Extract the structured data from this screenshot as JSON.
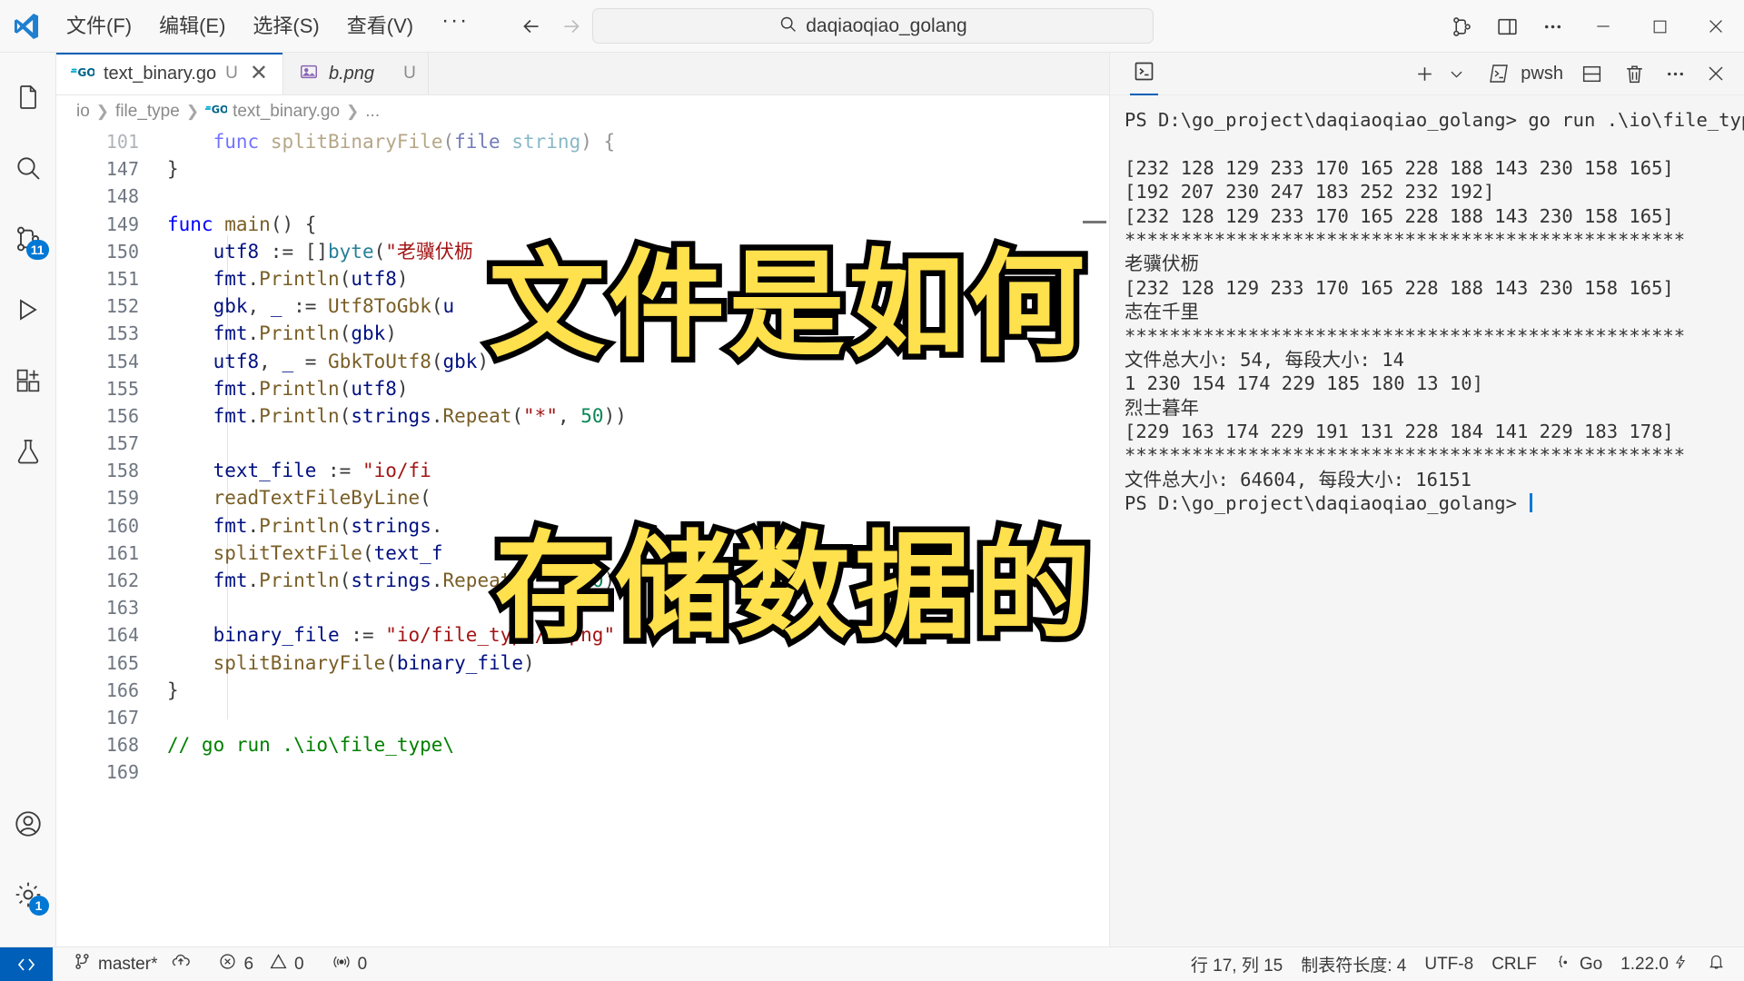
{
  "window": {
    "logo_icon": "vscode-logo-icon",
    "menus": [
      "文件(F)",
      "编辑(E)",
      "选择(S)",
      "查看(V)"
    ],
    "menu_more": "···",
    "nav_back_icon": "arrow-left-icon",
    "nav_forward_icon": "arrow-right-icon",
    "quick_open": {
      "search_icon": "search-icon",
      "value": "daqiaoqiao_golang"
    },
    "right_icons": [
      "source-control-graph-icon",
      "toggle-panel-icon",
      "more-actions-icon"
    ],
    "controls": {
      "minimize": "minimize-icon",
      "maximize": "maximize-icon",
      "close": "close-icon"
    }
  },
  "activitybar": {
    "items": [
      {
        "name": "explorer",
        "icon": "files-icon",
        "badge": ""
      },
      {
        "name": "search",
        "icon": "search-icon",
        "badge": ""
      },
      {
        "name": "source-control",
        "icon": "source-control-icon",
        "badge": "11"
      },
      {
        "name": "run-and-debug",
        "icon": "run-debug-icon",
        "badge": ""
      },
      {
        "name": "extensions",
        "icon": "extensions-icon",
        "badge": ""
      },
      {
        "name": "testing",
        "icon": "beaker-icon",
        "badge": ""
      }
    ],
    "bottom": [
      {
        "name": "accounts",
        "icon": "account-icon",
        "badge": ""
      },
      {
        "name": "manage",
        "icon": "gear-icon",
        "badge": "1"
      }
    ]
  },
  "editor": {
    "tabs": [
      {
        "icon": "go-file-icon",
        "label": "text_binary.go",
        "dirty": "U",
        "active": true,
        "preview": false,
        "close_icon": "close-icon"
      },
      {
        "icon": "image-file-icon",
        "label": "b.png",
        "dirty": "U",
        "active": false,
        "preview": true,
        "close_icon": ""
      }
    ],
    "breadcrumb": [
      "io",
      "file_type",
      "text_binary.go",
      "..."
    ],
    "breadcrumb_file_icon": "go-file-icon",
    "lines": [
      {
        "num": "101",
        "partial": true,
        "tokens": [
          {
            "t": "    ",
            "c": "pn"
          },
          {
            "t": "func",
            "c": "k"
          },
          {
            "t": " ",
            "c": "pn"
          },
          {
            "t": "splitBinaryFile",
            "c": "fn"
          },
          {
            "t": "(",
            "c": "pn"
          },
          {
            "t": "file",
            "c": "va"
          },
          {
            "t": " ",
            "c": "pn"
          },
          {
            "t": "string",
            "c": "ty"
          },
          {
            "t": ") {",
            "c": "pn"
          }
        ]
      },
      {
        "num": "147",
        "partial": false,
        "tokens": [
          {
            "t": "}",
            "c": "pn"
          }
        ]
      },
      {
        "num": "148",
        "partial": false,
        "tokens": []
      },
      {
        "num": "149",
        "partial": false,
        "tokens": [
          {
            "t": "func",
            "c": "k"
          },
          {
            "t": " ",
            "c": "pn"
          },
          {
            "t": "main",
            "c": "fn"
          },
          {
            "t": "() {",
            "c": "pn"
          }
        ]
      },
      {
        "num": "150",
        "partial": false,
        "tokens": [
          {
            "t": "    ",
            "c": "pn"
          },
          {
            "t": "utf8",
            "c": "va"
          },
          {
            "t": " := []",
            "c": "pn"
          },
          {
            "t": "byte",
            "c": "ty"
          },
          {
            "t": "(",
            "c": "pn"
          },
          {
            "t": "\"老骥伏枥",
            "c": "st"
          }
        ]
      },
      {
        "num": "151",
        "partial": false,
        "tokens": [
          {
            "t": "    ",
            "c": "pn"
          },
          {
            "t": "fmt",
            "c": "va"
          },
          {
            "t": ".",
            "c": "pn"
          },
          {
            "t": "Println",
            "c": "fn"
          },
          {
            "t": "(",
            "c": "pn"
          },
          {
            "t": "utf8",
            "c": "va"
          },
          {
            "t": ")",
            "c": "pn"
          }
        ]
      },
      {
        "num": "152",
        "partial": false,
        "tokens": [
          {
            "t": "    ",
            "c": "pn"
          },
          {
            "t": "gbk",
            "c": "va"
          },
          {
            "t": ", ",
            "c": "pn"
          },
          {
            "t": "_",
            "c": "va"
          },
          {
            "t": " := ",
            "c": "pn"
          },
          {
            "t": "Utf8ToGbk",
            "c": "fn"
          },
          {
            "t": "(",
            "c": "pn"
          },
          {
            "t": "u",
            "c": "va"
          }
        ]
      },
      {
        "num": "153",
        "partial": false,
        "tokens": [
          {
            "t": "    ",
            "c": "pn"
          },
          {
            "t": "fmt",
            "c": "va"
          },
          {
            "t": ".",
            "c": "pn"
          },
          {
            "t": "Println",
            "c": "fn"
          },
          {
            "t": "(",
            "c": "pn"
          },
          {
            "t": "gbk",
            "c": "va"
          },
          {
            "t": ")",
            "c": "pn"
          }
        ]
      },
      {
        "num": "154",
        "partial": false,
        "tokens": [
          {
            "t": "    ",
            "c": "pn"
          },
          {
            "t": "utf8",
            "c": "va"
          },
          {
            "t": ", ",
            "c": "pn"
          },
          {
            "t": "_",
            "c": "va"
          },
          {
            "t": " = ",
            "c": "pn"
          },
          {
            "t": "GbkToUtf8",
            "c": "fn"
          },
          {
            "t": "(",
            "c": "pn"
          },
          {
            "t": "gbk",
            "c": "va"
          },
          {
            "t": ")",
            "c": "pn"
          }
        ]
      },
      {
        "num": "155",
        "partial": false,
        "tokens": [
          {
            "t": "    ",
            "c": "pn"
          },
          {
            "t": "fmt",
            "c": "va"
          },
          {
            "t": ".",
            "c": "pn"
          },
          {
            "t": "Println",
            "c": "fn"
          },
          {
            "t": "(",
            "c": "pn"
          },
          {
            "t": "utf8",
            "c": "va"
          },
          {
            "t": ")",
            "c": "pn"
          }
        ]
      },
      {
        "num": "156",
        "partial": false,
        "tokens": [
          {
            "t": "    ",
            "c": "pn"
          },
          {
            "t": "fmt",
            "c": "va"
          },
          {
            "t": ".",
            "c": "pn"
          },
          {
            "t": "Println",
            "c": "fn"
          },
          {
            "t": "(",
            "c": "pn"
          },
          {
            "t": "strings",
            "c": "va"
          },
          {
            "t": ".",
            "c": "pn"
          },
          {
            "t": "Repeat",
            "c": "fn"
          },
          {
            "t": "(",
            "c": "pn"
          },
          {
            "t": "\"*\"",
            "c": "st"
          },
          {
            "t": ", ",
            "c": "pn"
          },
          {
            "t": "50",
            "c": "nu"
          },
          {
            "t": "))",
            "c": "pn"
          }
        ]
      },
      {
        "num": "157",
        "partial": false,
        "tokens": []
      },
      {
        "num": "158",
        "partial": false,
        "tokens": [
          {
            "t": "    ",
            "c": "pn"
          },
          {
            "t": "text_file",
            "c": "va"
          },
          {
            "t": " := ",
            "c": "pn"
          },
          {
            "t": "\"io/fi",
            "c": "st"
          }
        ]
      },
      {
        "num": "159",
        "partial": false,
        "tokens": [
          {
            "t": "    ",
            "c": "pn"
          },
          {
            "t": "readTextFileByLine",
            "c": "fn"
          },
          {
            "t": "(",
            "c": "pn"
          }
        ]
      },
      {
        "num": "160",
        "partial": false,
        "tokens": [
          {
            "t": "    ",
            "c": "pn"
          },
          {
            "t": "fmt",
            "c": "va"
          },
          {
            "t": ".",
            "c": "pn"
          },
          {
            "t": "Println",
            "c": "fn"
          },
          {
            "t": "(",
            "c": "pn"
          },
          {
            "t": "strings",
            "c": "va"
          },
          {
            "t": ".",
            "c": "pn"
          }
        ]
      },
      {
        "num": "161",
        "partial": false,
        "tokens": [
          {
            "t": "    ",
            "c": "pn"
          },
          {
            "t": "splitTextFile",
            "c": "fn"
          },
          {
            "t": "(",
            "c": "pn"
          },
          {
            "t": "text_f",
            "c": "va"
          }
        ]
      },
      {
        "num": "162",
        "partial": false,
        "tokens": [
          {
            "t": "    ",
            "c": "pn"
          },
          {
            "t": "fmt",
            "c": "va"
          },
          {
            "t": ".",
            "c": "pn"
          },
          {
            "t": "Println",
            "c": "fn"
          },
          {
            "t": "(",
            "c": "pn"
          },
          {
            "t": "strings",
            "c": "va"
          },
          {
            "t": ".",
            "c": "pn"
          },
          {
            "t": "Repeat",
            "c": "fn"
          },
          {
            "t": "(",
            "c": "pn"
          },
          {
            "t": "\"*\"",
            "c": "st"
          },
          {
            "t": ", ",
            "c": "pn"
          },
          {
            "t": "50",
            "c": "nu"
          },
          {
            "t": "))",
            "c": "pn"
          }
        ]
      },
      {
        "num": "163",
        "partial": false,
        "tokens": []
      },
      {
        "num": "164",
        "partial": false,
        "tokens": [
          {
            "t": "    ",
            "c": "pn"
          },
          {
            "t": "binary_file",
            "c": "va"
          },
          {
            "t": " := ",
            "c": "pn"
          },
          {
            "t": "\"io/file_type/b.png\"",
            "c": "st"
          }
        ]
      },
      {
        "num": "165",
        "partial": false,
        "tokens": [
          {
            "t": "    ",
            "c": "pn"
          },
          {
            "t": "splitBinaryFile",
            "c": "fn"
          },
          {
            "t": "(",
            "c": "pn"
          },
          {
            "t": "binary_file",
            "c": "va"
          },
          {
            "t": ")",
            "c": "pn"
          }
        ]
      },
      {
        "num": "166",
        "partial": false,
        "tokens": [
          {
            "t": "}",
            "c": "pn"
          }
        ]
      },
      {
        "num": "167",
        "partial": false,
        "tokens": []
      },
      {
        "num": "168",
        "partial": false,
        "tokens": [
          {
            "t": "// go run .\\io\\file_type\\",
            "c": "cm"
          }
        ]
      },
      {
        "num": "169",
        "partial": false,
        "tokens": []
      }
    ]
  },
  "terminal": {
    "tab_icon": "terminal-icon",
    "toolbar": {
      "new_icon": "plus-icon",
      "dropdown_icon": "chevron-down-icon",
      "shell_icon": "terminal-icon",
      "shell_label": "pwsh",
      "split_icon": "split-panel-icon",
      "kill_icon": "trash-icon",
      "more_icon": "more-actions-icon",
      "close_icon": "close-icon"
    },
    "lines": [
      "PS D:\\go_project\\daqiaoqiao_golang> go run .\\io\\file_type\\",
      "",
      "[232 128 129 233 170 165 228 188 143 230 158 165]",
      "[192 207 230 247 183 252 232 192]",
      "[232 128 129 233 170 165 228 188 143 230 158 165]",
      "**************************************************",
      "老骥伏枥",
      "[232 128 129 233 170 165 228 188 143 230 158 165]",
      "志在千里",
      "**************************************************",
      "文件总大小: 54, 每段大小: 14",
      "1 230 154 174 229 185 180 13 10]",
      "烈士暮年",
      "[229 163 174 229 191 131 228 184 141 229 183 178]",
      "**************************************************",
      "文件总大小: 64604, 每段大小: 16151",
      "PS D:\\go_project\\daqiaoqiao_golang> "
    ]
  },
  "statusbar": {
    "remote_icon": "remote-window-icon",
    "left": [
      {
        "icon": "source-control-icon",
        "label": "master*"
      },
      {
        "icon": "sync-icon",
        "label": ""
      },
      {
        "icon": "error-icon",
        "label": "6"
      },
      {
        "icon": "warning-icon",
        "label": "0"
      },
      {
        "icon": "ports-icon",
        "label": "0"
      }
    ],
    "right": [
      {
        "icon": "",
        "label": "行 17, 列 15"
      },
      {
        "icon": "",
        "label": "制表符长度: 4"
      },
      {
        "icon": "",
        "label": "UTF-8"
      },
      {
        "icon": "",
        "label": "CRLF"
      },
      {
        "icon": "go-lang-icon",
        "label": "Go"
      },
      {
        "icon": "",
        "label": "1.22.0"
      },
      {
        "icon": "lightning-icon",
        "label": ""
      },
      {
        "icon": "bell-icon",
        "label": ""
      }
    ]
  },
  "overlay": {
    "line1": "文件是如何",
    "line2": "存储数据的",
    "fill_color": "#ffe04d",
    "stroke_color": "#000000"
  }
}
